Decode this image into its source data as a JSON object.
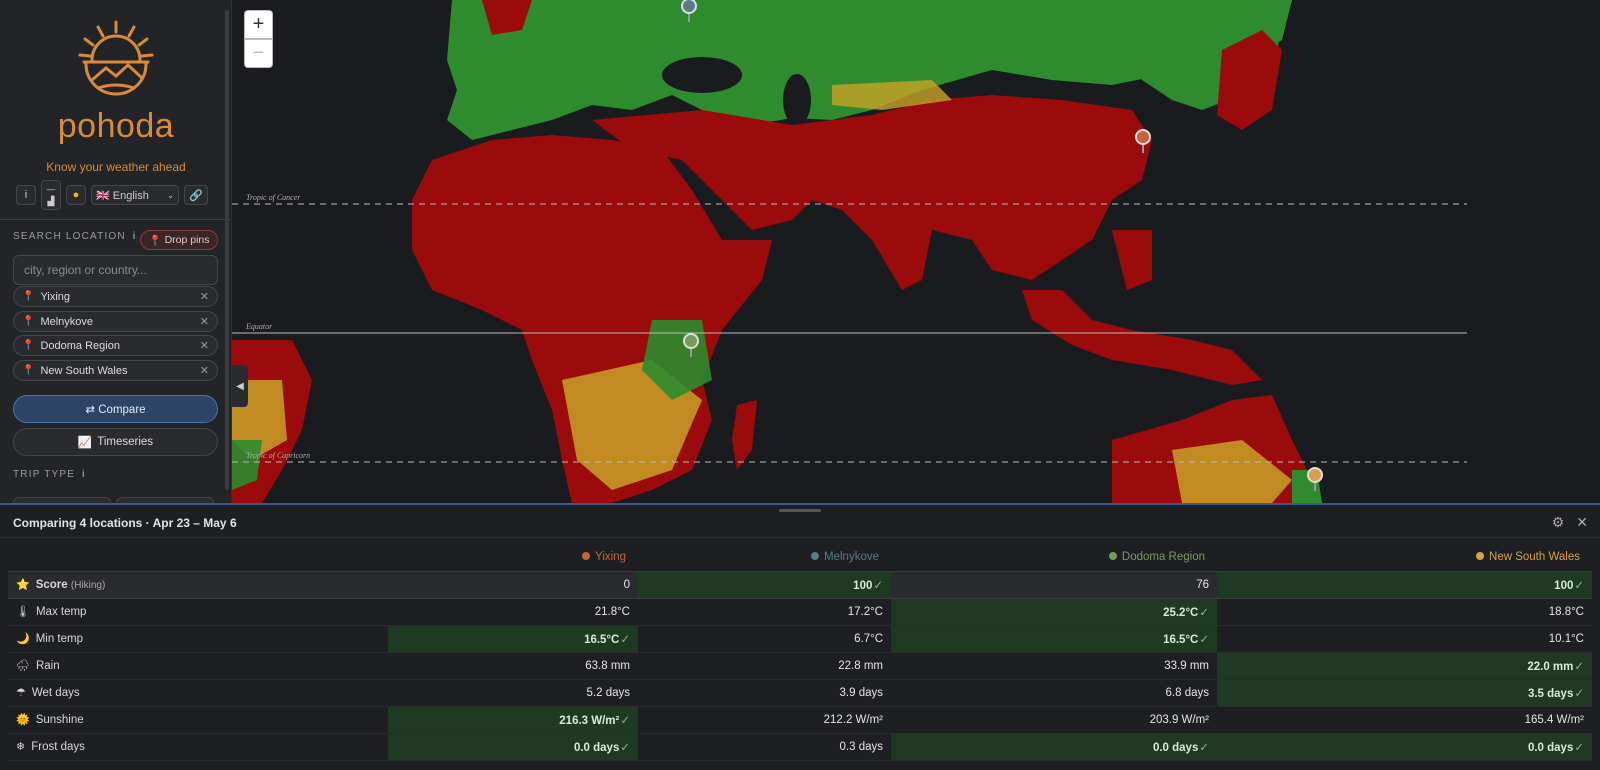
{
  "brand": {
    "name": "pohoda",
    "tagline": "Know your weather ahead"
  },
  "toolbar": {
    "info": "i",
    "chart_top": "—",
    "chart_bottom": "🏔",
    "theme_icon": "sun-icon",
    "language": "🇬🇧 English",
    "link_icon": "link-icon"
  },
  "search": {
    "label": "SEARCH LOCATION",
    "info": "i",
    "drop_pins": "Drop pins",
    "placeholder": "city, region or country..."
  },
  "locations": [
    "Yixing",
    "Melnykove",
    "Dodoma Region",
    "New South Wales"
  ],
  "buttons": {
    "compare": "⇄ Compare",
    "timeseries": "Timeseries"
  },
  "trip": {
    "label": "TRIP TYPE",
    "info": "i"
  },
  "map": {
    "zoom_in": "+",
    "zoom_out": "−",
    "lines": {
      "cancer": "Tropic of Cancer",
      "equator": "Equator",
      "capricorn": "Tropic of Capricorn"
    },
    "colors": {
      "good": "#2e8b2e",
      "bad": "#9b0b0b",
      "mid": "#c9a227",
      "sea": "#1a1b1e"
    }
  },
  "panel": {
    "title": "Comparing 4 locations · Apr 23 – May 6",
    "columns": [
      {
        "name": "Yixing",
        "color": "#c8623b"
      },
      {
        "name": "Melnykove",
        "color": "#5a7a86"
      },
      {
        "name": "Dodoma Region",
        "color": "#7a9a5a"
      },
      {
        "name": "New South Wales",
        "color": "#d7a04a"
      }
    ],
    "rows": [
      {
        "icon": "⭐",
        "label": "Score",
        "sub": "(Hiking)",
        "values": [
          "0",
          "100",
          "76",
          "100"
        ]
      },
      {
        "icon": "🌡",
        "label": "Max temp",
        "values": [
          "21.8°C",
          "17.2°C",
          "25.2°C",
          "18.8°C"
        ]
      },
      {
        "icon": "🌙",
        "label": "Min temp",
        "values": [
          "16.5°C",
          "6.7°C",
          "16.5°C",
          "10.1°C"
        ]
      },
      {
        "icon": "🌧",
        "label": "Rain",
        "values": [
          "63.8 mm",
          "22.8 mm",
          "33.9 mm",
          "22.0 mm"
        ]
      },
      {
        "icon": "☂",
        "label": "Wet days",
        "values": [
          "5.2 days",
          "3.9 days",
          "6.8 days",
          "3.5 days"
        ]
      },
      {
        "icon": "🌞",
        "label": "Sunshine",
        "values": [
          "216.3 W/m²",
          "212.2 W/m²",
          "203.9 W/m²",
          "165.4 W/m²"
        ]
      },
      {
        "icon": "❄",
        "label": "Frost days",
        "values": [
          "0.0 days",
          "0.3 days",
          "0.0 days",
          "0.0 days"
        ]
      }
    ],
    "best": [
      [
        1,
        3
      ],
      [
        2
      ],
      [
        0,
        2
      ],
      [
        3
      ],
      [
        3
      ],
      [
        0
      ],
      [
        0,
        2,
        3
      ]
    ]
  }
}
